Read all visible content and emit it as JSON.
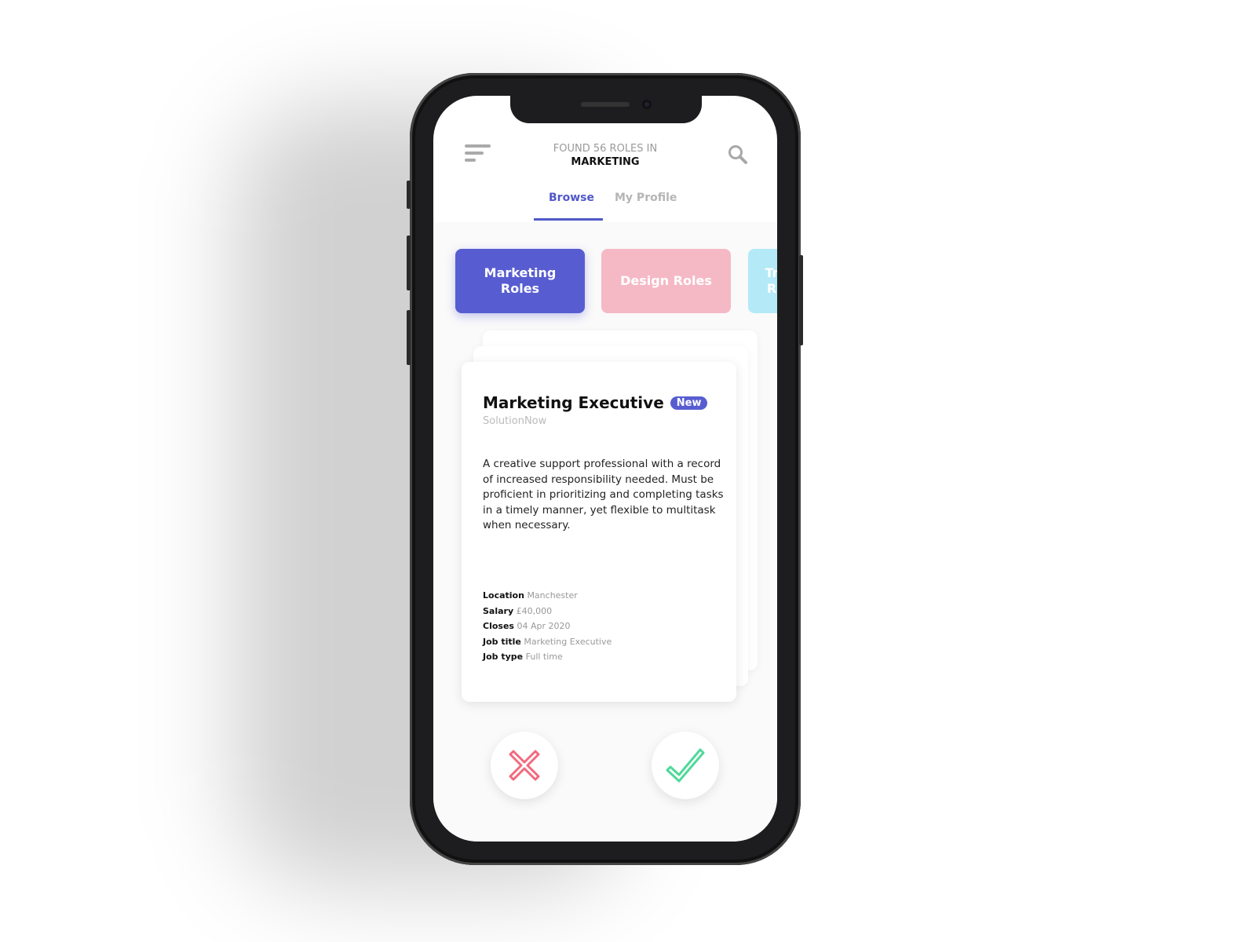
{
  "header": {
    "title_line1": "FOUND 56 ROLES IN",
    "title_line2": "MARKETING",
    "menu_icon": "menu-icon",
    "search_icon": "search-icon"
  },
  "tabs": [
    {
      "label": "Browse",
      "active": true
    },
    {
      "label": "My Profile",
      "active": false
    }
  ],
  "categories": [
    {
      "label": "Marketing Roles",
      "color": "#575dd0"
    },
    {
      "label": "Design Roles",
      "color": "#f5b9c5"
    },
    {
      "label": "Tr R",
      "color": "#b4e9f8"
    }
  ],
  "job": {
    "title": "Marketing Executive",
    "badge": "New",
    "company": "SolutionNow",
    "description": "A creative support professional with a record of increased responsibility needed. Must be proficient in prioritizing and completing tasks in a timely manner, yet flexible to multitask when necessary.",
    "details": [
      {
        "label": "Location",
        "value": "Manchester"
      },
      {
        "label": "Salary",
        "value": "£40,000"
      },
      {
        "label": "Closes",
        "value": "04 Apr 2020"
      },
      {
        "label": "Job title",
        "value": "Marketing Executive"
      },
      {
        "label": "Job type",
        "value": "Full time"
      }
    ]
  },
  "actions": {
    "reject_icon": "x-icon",
    "reject_color": "#f06a7e",
    "accept_icon": "check-icon",
    "accept_color": "#4fd99a"
  }
}
